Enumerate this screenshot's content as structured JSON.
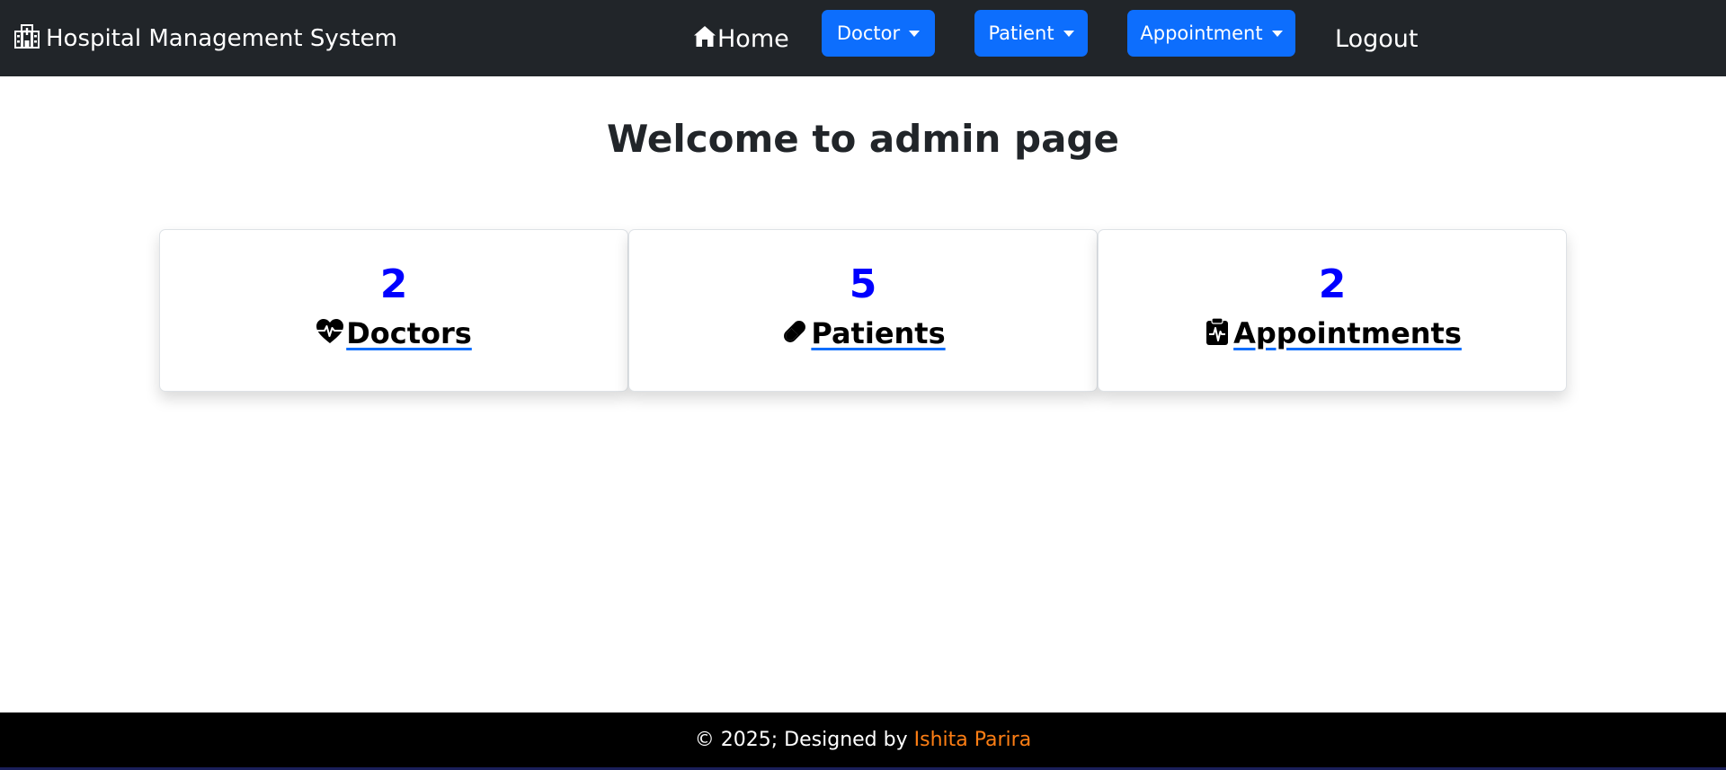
{
  "navbar": {
    "brand": {
      "icon": "hospital-icon",
      "label": "Hospital Management System"
    },
    "home": {
      "icon": "house-icon",
      "label": "Home"
    },
    "dropdowns": [
      {
        "label": "Doctor",
        "icon": "caret-down-icon"
      },
      {
        "label": "Patient",
        "icon": "caret-down-icon"
      },
      {
        "label": "Appointment",
        "icon": "caret-down-icon"
      }
    ],
    "logout": "Logout"
  },
  "main": {
    "heading": "Welcome to admin page",
    "cards": [
      {
        "count": "2",
        "label": "Doctors",
        "icon": "heart-pulse-icon"
      },
      {
        "count": "5",
        "label": "Patients",
        "icon": "capsule-icon"
      },
      {
        "count": "2",
        "label": "Appointments",
        "icon": "clipboard-pulse-icon"
      }
    ]
  },
  "footer": {
    "text": "© 2025; Designed by",
    "author": "Ishita Parira"
  },
  "colors": {
    "navbar_bg": "#212529",
    "button_primary": "#0d6efd",
    "count_text": "#0000ff",
    "footer_bg": "#000000",
    "author_text": "#fd7e14"
  }
}
